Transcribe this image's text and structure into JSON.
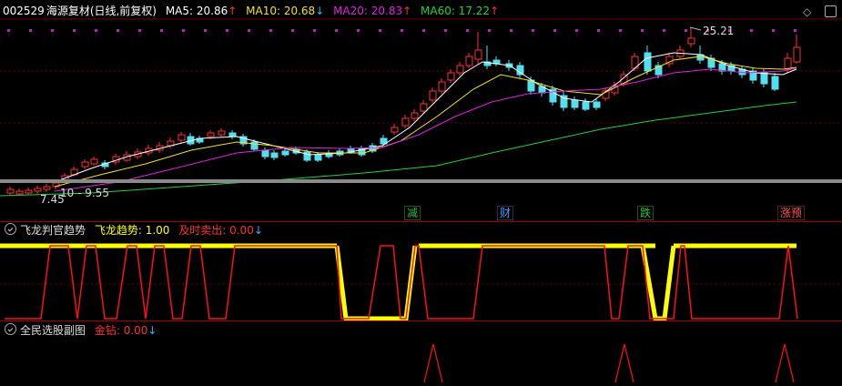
{
  "main_header": {
    "symbol": "002529",
    "name": "海源复材(日线,前复权)",
    "ma5": "MA5: 20.86",
    "ma5_arrow": "↑",
    "ma10": "MA10: 20.68",
    "ma10_arrow": "↓",
    "ma20": "MA20: 20.83",
    "ma20_arrow": "↑",
    "ma60": "MA60: 17.22",
    "ma60_arrow": "↑"
  },
  "price_annotations": {
    "high": "25.21",
    "low": "7.45",
    "range": "10 - 9.55"
  },
  "signal_tags": [
    {
      "text": "减",
      "color": "#20c040"
    },
    {
      "text": "财",
      "color": "#30a0ff"
    },
    {
      "text": "跌",
      "color": "#20c040"
    },
    {
      "text": "涨预",
      "color": "#ff5050"
    }
  ],
  "indicator1": {
    "name": "飞龙判官趋势",
    "trend_label": "飞龙趋势: 1.00",
    "sell_label": "及时卖出: 0.00",
    "sell_arrow": "↓"
  },
  "indicator2": {
    "name": "全民选股副图",
    "gold_label": "金钻: 0.00",
    "gold_arrow": "↓"
  },
  "colors": {
    "bull": "#ff3030",
    "bear": "#50e0f0",
    "ma5": "#ffffff",
    "ma10": "#f0e020",
    "ma20": "#e020e0",
    "ma60": "#20d040",
    "trend_yellow": "#ffff00",
    "trend_red": "#ff1010"
  },
  "icons": [
    "diamond-icon",
    "window-icon",
    "gear-icon"
  ]
}
